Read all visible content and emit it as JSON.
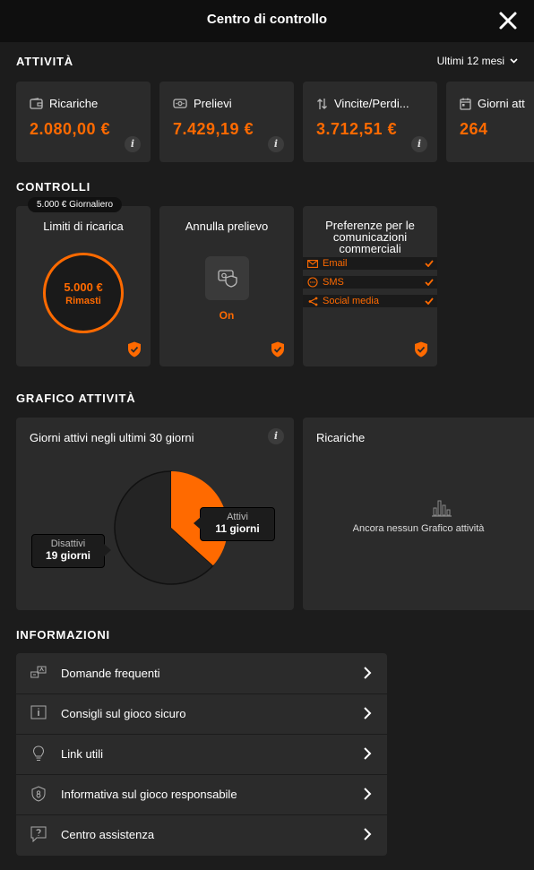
{
  "header": {
    "title": "Centro di controllo"
  },
  "activity": {
    "title": "ATTIVITÀ",
    "period": "Ultimi 12 mesi",
    "stats": [
      {
        "label": "Ricariche",
        "value": "2.080,00 €",
        "icon": "wallet-icon"
      },
      {
        "label": "Prelievi",
        "value": "7.429,19 €",
        "icon": "banknote-icon"
      },
      {
        "label": "Vincite/Perdi...",
        "value": "3.712,51 €",
        "icon": "arrows-up-down-icon"
      },
      {
        "label": "Giorni att",
        "value": "264",
        "icon": "calendar-icon"
      }
    ],
    "info_glyph": "i"
  },
  "controls": {
    "title": "CONTROLLI",
    "deposit": {
      "badge": "5.000 € Giornaliero",
      "title": "Limiti di ricarica",
      "amount": "5.000 €",
      "remaining": "Rimasti"
    },
    "withdraw": {
      "title": "Annulla prelievo",
      "state": "On"
    },
    "prefs": {
      "title": "Preferenze per le comunicazioni commerciali",
      "items": [
        {
          "label": "Email",
          "icon": "envelope-icon"
        },
        {
          "label": "SMS",
          "icon": "chat-bubble-icon"
        },
        {
          "label": "Social media",
          "icon": "share-icon"
        }
      ]
    }
  },
  "chart_section": {
    "title": "GRAFICO ATTIVITÀ",
    "recharges_title": "Ricariche",
    "empty": "Ancora nessun Grafico attività"
  },
  "chart_data": {
    "type": "pie",
    "title": "Giorni attivi negli ultimi 30 giorni",
    "series": [
      {
        "name": "Attivi",
        "value": 11,
        "label": "11 giorni",
        "color": "#ff6a00"
      },
      {
        "name": "Disattivi",
        "value": 19,
        "label": "19 giorni",
        "color": "#242424"
      }
    ]
  },
  "info": {
    "title": "INFORMAZIONI",
    "items": [
      {
        "label": "Domande frequenti",
        "icon": "faq-icon"
      },
      {
        "label": "Consigli sul gioco sicuro",
        "icon": "info-box-icon"
      },
      {
        "label": "Link utili",
        "icon": "lightbulb-icon"
      },
      {
        "label": "Informativa sul gioco responsabile",
        "icon": "age-badge-icon"
      },
      {
        "label": "Centro assistenza",
        "icon": "help-chat-icon"
      }
    ]
  },
  "colors": {
    "accent": "#ff6a00",
    "card": "#2b2b2b",
    "background": "#1c1c1c",
    "header": "#0f0f0f"
  }
}
